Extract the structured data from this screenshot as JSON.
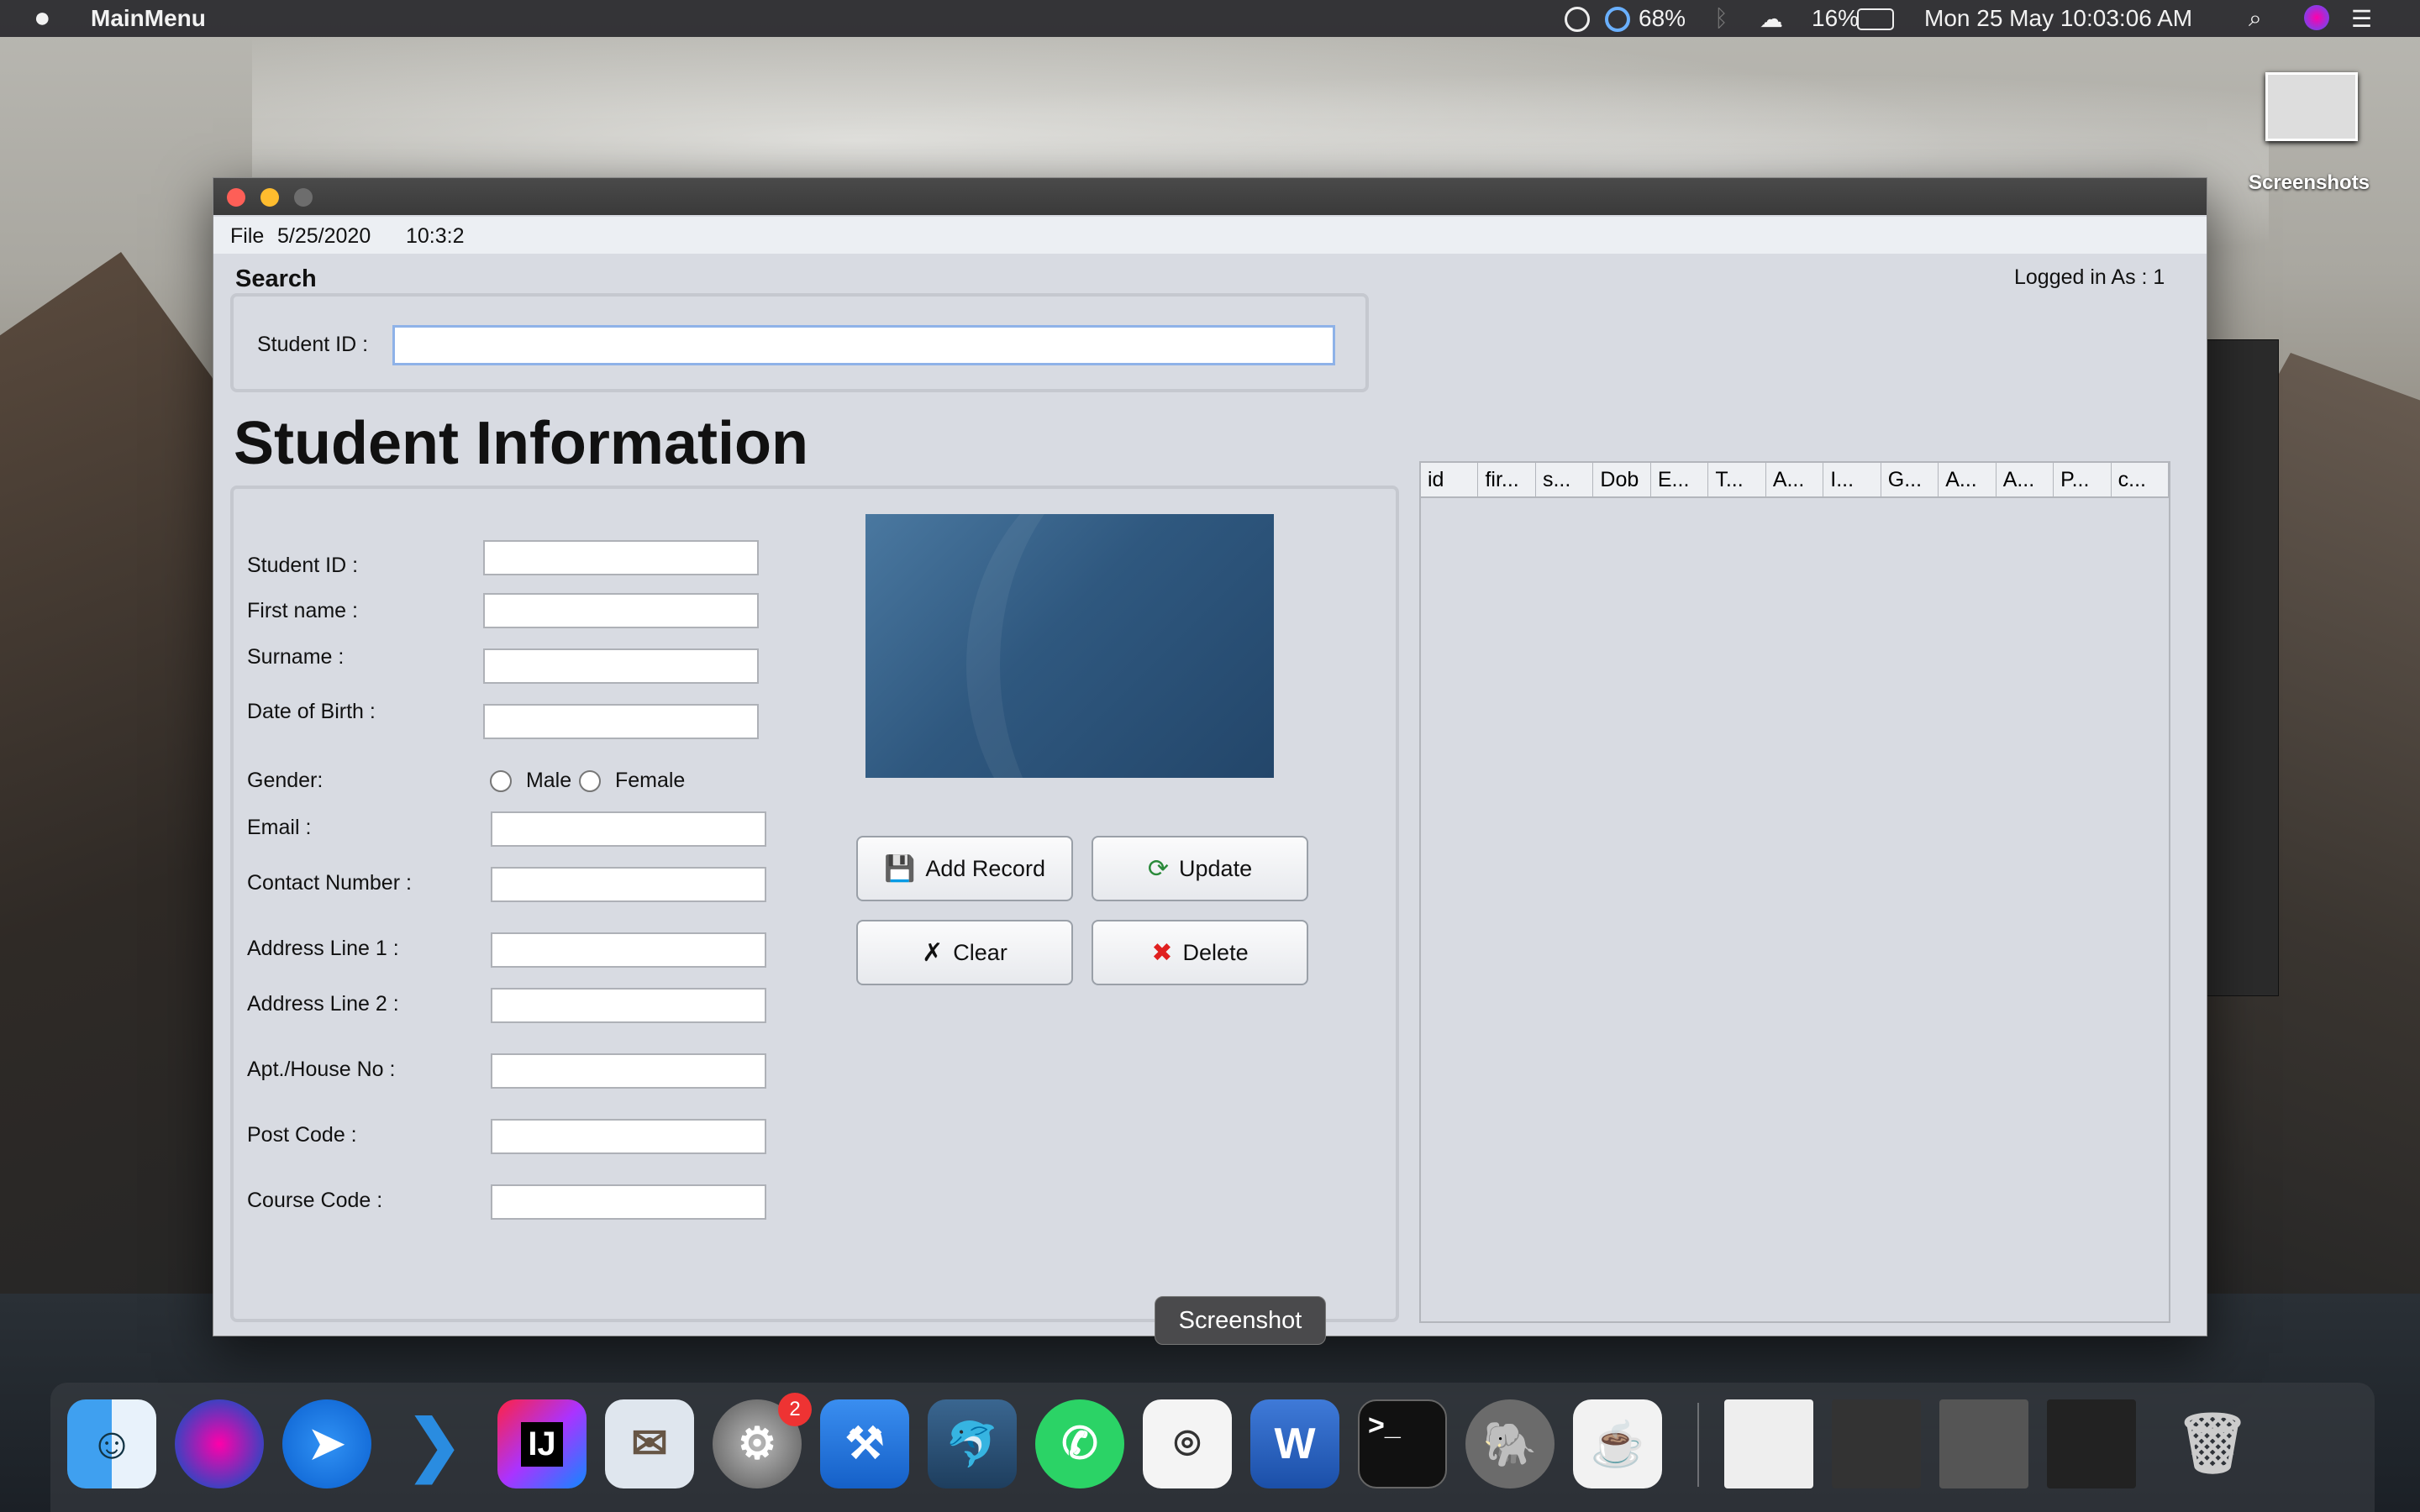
{
  "menubar": {
    "app_name": "MainMenu",
    "battery_percent_a": "68%",
    "battery_percent_b": "16%",
    "clock": "Mon 25 May  10:03:06 AM"
  },
  "desktop": {
    "screenshots_label": "Screenshots"
  },
  "window": {
    "menu_file": "File",
    "menu_date": "5/25/2020",
    "menu_time": "10:3:2",
    "logged_in": "Logged in As :  1",
    "search": {
      "title": "Search",
      "student_id_label": "Student ID :",
      "student_id_value": ""
    },
    "form": {
      "heading": "Student Information",
      "student_id": "Student ID :",
      "first_name": "First name :",
      "surname": "Surname :",
      "dob": "Date of Birth :",
      "gender": "Gender:",
      "male": "Male",
      "female": "Female",
      "email": "Email :",
      "contact": "Contact Number :",
      "addr1": "Address Line 1 :",
      "addr2": "Address Line 2 :",
      "apt": "Apt./House No :",
      "postcode": "Post Code :",
      "course": "Course Code :"
    },
    "buttons": {
      "add": "Add Record",
      "update": "Update",
      "clear": "Clear",
      "delete": "Delete"
    },
    "table": {
      "columns": [
        "id",
        "fir...",
        "s...",
        "Dob",
        "E...",
        "T...",
        "A...",
        "I...",
        "G...",
        "A...",
        "A...",
        "P...",
        "c..."
      ]
    }
  },
  "dock": {
    "tooltip": "Screenshot",
    "badge_count": "2"
  },
  "colors": {
    "window_bg": "#d8dbe2",
    "photo_panel": "#2f587f",
    "delete_icon": "#e02020",
    "update_icon": "#2a8a3a"
  }
}
